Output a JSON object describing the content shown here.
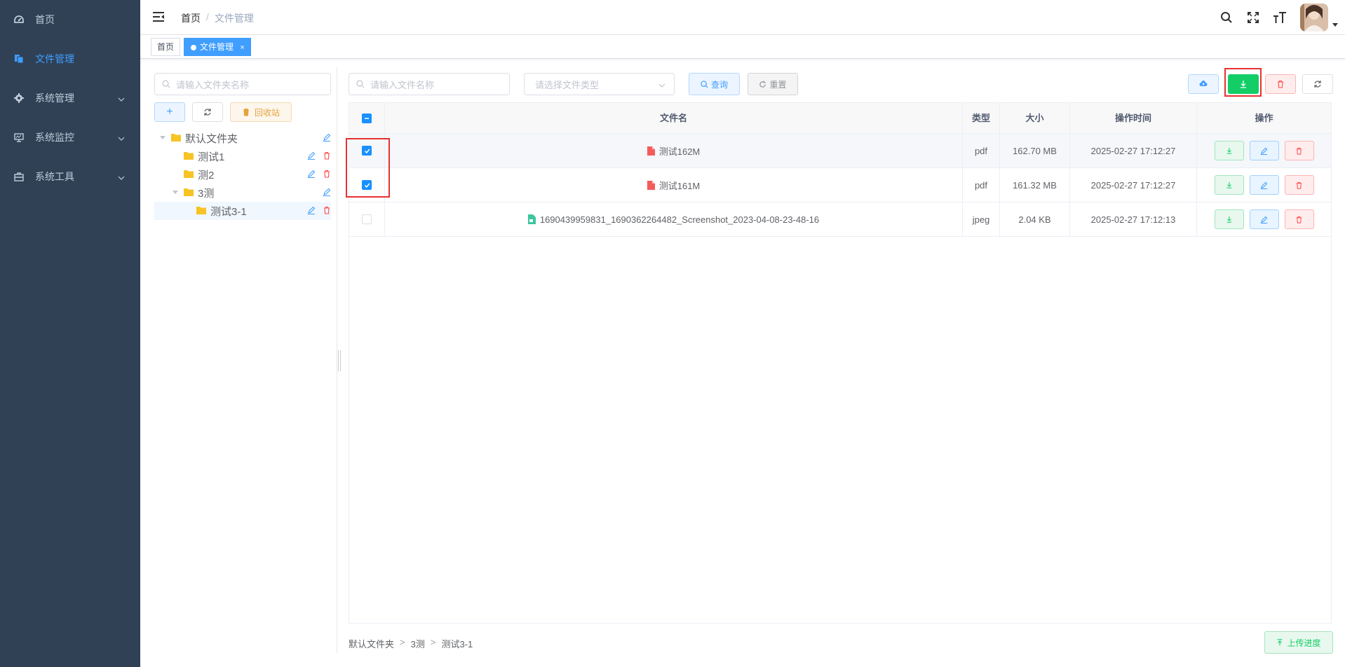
{
  "sidebar": {
    "items": [
      {
        "label": "首页",
        "icon": "dashboard-icon"
      },
      {
        "label": "文件管理",
        "icon": "file-icon",
        "active": true
      },
      {
        "label": "系统管理",
        "icon": "gear-icon"
      },
      {
        "label": "系统监控",
        "icon": "monitor-icon"
      },
      {
        "label": "系统工具",
        "icon": "toolbox-icon"
      }
    ]
  },
  "navbar": {
    "breadcrumb": [
      "首页",
      "文件管理"
    ],
    "separator": "/"
  },
  "tags": [
    {
      "label": "首页"
    },
    {
      "label": "文件管理",
      "close": "×",
      "active": true
    }
  ],
  "left": {
    "folder_search_placeholder": "请输入文件夹名称",
    "add_label": "+",
    "recycle_label": "回收站",
    "tree": [
      {
        "label": "默认文件夹",
        "level": 0,
        "expanded": true
      },
      {
        "label": "测试1",
        "level": 1
      },
      {
        "label": "测2",
        "level": 1
      },
      {
        "label": "3测",
        "level": 1,
        "expanded": true
      },
      {
        "label": "测试3-1",
        "level": 2,
        "selected": true
      }
    ]
  },
  "toolbar": {
    "file_search_placeholder": "请输入文件名称",
    "type_select_placeholder": "请选择文件类型",
    "query_label": "查询",
    "reset_label": "重置"
  },
  "table": {
    "headers": [
      "文件名",
      "类型",
      "大小",
      "操作时间",
      "操作"
    ],
    "rows": [
      {
        "name": "测试162M",
        "type": "pdf",
        "size": "162.70 MB",
        "time": "2025-02-27 17:12:27",
        "checked": true,
        "icon": "pdf-icon"
      },
      {
        "name": "测试161M",
        "type": "pdf",
        "size": "161.32 MB",
        "time": "2025-02-27 17:12:27",
        "checked": true,
        "icon": "pdf-icon"
      },
      {
        "name": "1690439959831_1690362264482_Screenshot_2023-04-08-23-48-16",
        "type": "jpeg",
        "size": "2.04 KB",
        "time": "2025-02-27 17:12:13",
        "checked": false,
        "icon": "image-file-icon"
      }
    ]
  },
  "footer": {
    "path": [
      "默认文件夹",
      "3测",
      "测试3-1"
    ],
    "path_sep": ">",
    "upload_progress_label": "上传进度"
  },
  "colors": {
    "sidebar_bg": "#304156",
    "primary": "#409eff",
    "success": "#13ce66",
    "danger": "#ff4949",
    "highlight_box": "#e63131"
  }
}
